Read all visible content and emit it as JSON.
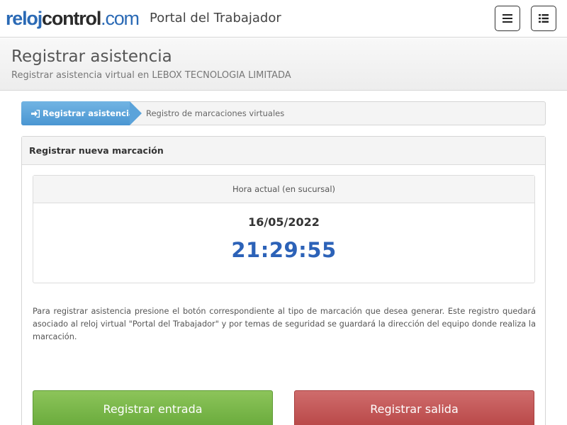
{
  "brand": {
    "logo_part1": "reloj",
    "logo_part2": "control",
    "logo_part3": ".com",
    "portal": "Portal del Trabajador",
    "color_blue": "#2b6ab5"
  },
  "header": {
    "title": "Registrar asistencia",
    "subtitle": "Registrar asistencia virtual en LEBOX TECNOLOGIA LIMITADA"
  },
  "nav_icons": [
    "menu-icon",
    "list-icon"
  ],
  "breadcrumb": {
    "active_label": "Registrar asistencia",
    "active_icon": "sign-in-icon",
    "next_label": "Registro de marcaciones virtuales"
  },
  "panel": {
    "title": "Registrar nueva marcación",
    "clock": {
      "heading": "Hora actual (en sucursal)",
      "date": "16/05/2022",
      "time": "21:29:55"
    },
    "info": "Para registrar asistencia presione el botón correspondiente al tipo de marcación que desea generar. Este registro quedará asociado al reloj virtual \"Portal del Trabajador\" y por temas de seguridad se guardará la dirección del equipo donde realiza la marcación.",
    "btn_in": "Registrar entrada",
    "btn_out": "Registrar salida",
    "color_in": "#7ab84a",
    "color_out": "#c25757"
  }
}
